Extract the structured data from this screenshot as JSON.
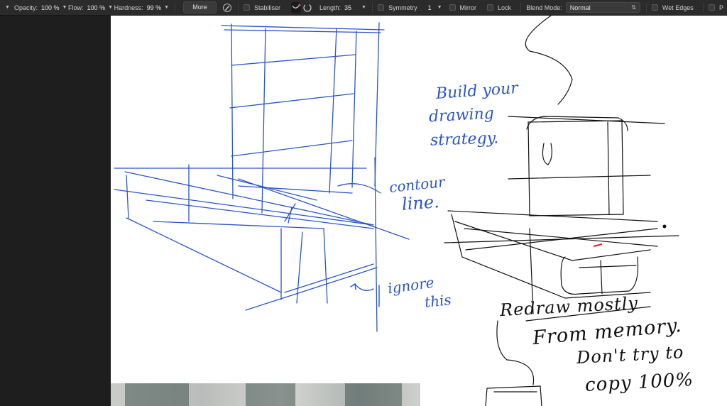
{
  "toolbar": {
    "opacity_label": "Opacity:",
    "opacity_value": "100 %",
    "flow_label": "Flow:",
    "flow_value": "100 %",
    "hardness_label": "Hardness:",
    "hardness_value": "99 %",
    "more_label": "More",
    "stabiliser_label": "Stabiliser",
    "length_label": "Length:",
    "length_value": "35",
    "symmetry_label": "Symmetry",
    "symmetry_value": "1",
    "mirror_label": "Mirror",
    "lock_label": "Lock",
    "blend_label": "Blend Mode:",
    "blend_value": "Normal",
    "wet_edges_label": "Wet Edges",
    "trailing_label": "P"
  },
  "canvas": {
    "notes": {
      "strategy_1": "Build your",
      "strategy_2": "drawing",
      "strategy_3": "strategy.",
      "contour_1": "contour",
      "contour_2": "line.",
      "ignore_1": "ignore",
      "ignore_2": "this",
      "memory_1": "Redraw mostly",
      "memory_2": "From memory.",
      "memory_3": "Don't try to",
      "memory_4": "copy 100%"
    }
  },
  "colors": {
    "ink_blue": "#2a55c8",
    "ink_black": "#111111",
    "toolbar_bg": "#2b2b2b",
    "workspace_bg": "#1e1e1e",
    "canvas_bg": "#ffffff"
  },
  "icons": {
    "brush_settings": "brush-icon",
    "stabiliser_rope": "rope-mode-icon",
    "stabiliser_window": "window-mode-icon"
  }
}
